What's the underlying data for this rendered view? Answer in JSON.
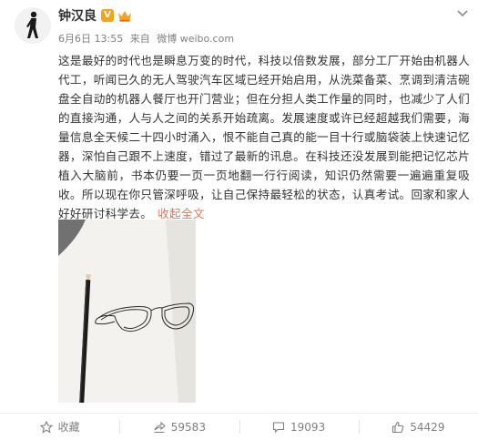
{
  "post": {
    "author": "钟汉良",
    "badge_v": "V",
    "timestamp": "6月6日 13:55",
    "source_prefix": "来自",
    "source": "微博 weibo.com",
    "text": "这是最好的时代也是瞬息万变的时代，科技以倍数发展，部分工厂开始由机器人代工，听闻已久的无人驾驶汽车区域已经开始启用，从洗菜备菜、烹调到清洁碗盘全自动的机器人餐厅也开门营业；但在分担人类工作量的同时，也减少了人们的直接沟通，人与人之间的关系开始疏离。发展速度或许已经超越我们需要，海量信息全天候二十四小时涌入，恨不能自己真的能一目十行或脑袋装上快速记忆器，深怕自己跟不上速度，错过了最新的讯息。在科技还没发展到能把记忆芯片植入大脑前，书本仍要一页一页地翻一行行阅读，知识仍然需要一遍遍重复吸收。所以现在你只管深呼吸，让自己保持最轻松的状态，认真考试。回家和家人好好研讨科学去。",
    "collapse_label": "收起全文"
  },
  "actions": [
    {
      "label": "收藏",
      "icon": "star-icon"
    },
    {
      "label": "59583",
      "icon": "share-icon"
    },
    {
      "label": "19093",
      "icon": "comment-icon"
    },
    {
      "label": "54429",
      "icon": "like-icon"
    }
  ],
  "colors": {
    "accent": "#eb7350",
    "badge": "#f7a21b",
    "meta_text": "#808080"
  }
}
